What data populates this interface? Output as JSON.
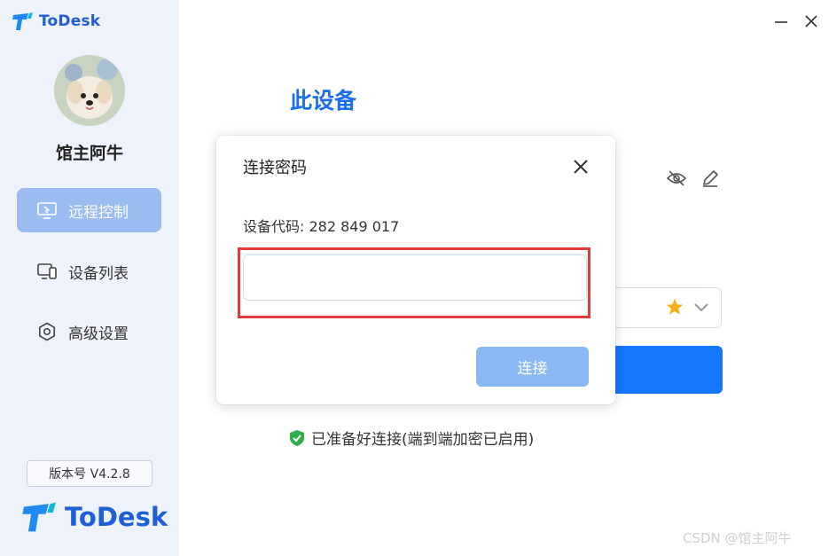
{
  "app": {
    "name": "ToDesk"
  },
  "sidebar": {
    "username": "馆主阿牛",
    "items": [
      {
        "label": "远程控制",
        "icon": "remote-control-icon",
        "active": true
      },
      {
        "label": "设备列表",
        "icon": "device-list-icon",
        "active": false
      },
      {
        "label": "高级设置",
        "icon": "settings-icon",
        "active": false
      }
    ],
    "version": "版本号 V4.2.8"
  },
  "main": {
    "title": "此设备",
    "status": "已准备好连接(端到端加密已启用)"
  },
  "dialog": {
    "title": "连接密码",
    "device_code": "设备代码: 282 849 017",
    "password_value": "",
    "connect_label": "连接"
  },
  "watermark": "CSDN @馆主阿牛",
  "colors": {
    "brand": "#1f5fd6",
    "accent": "#1677ff",
    "highlight": "#e23b3b"
  }
}
